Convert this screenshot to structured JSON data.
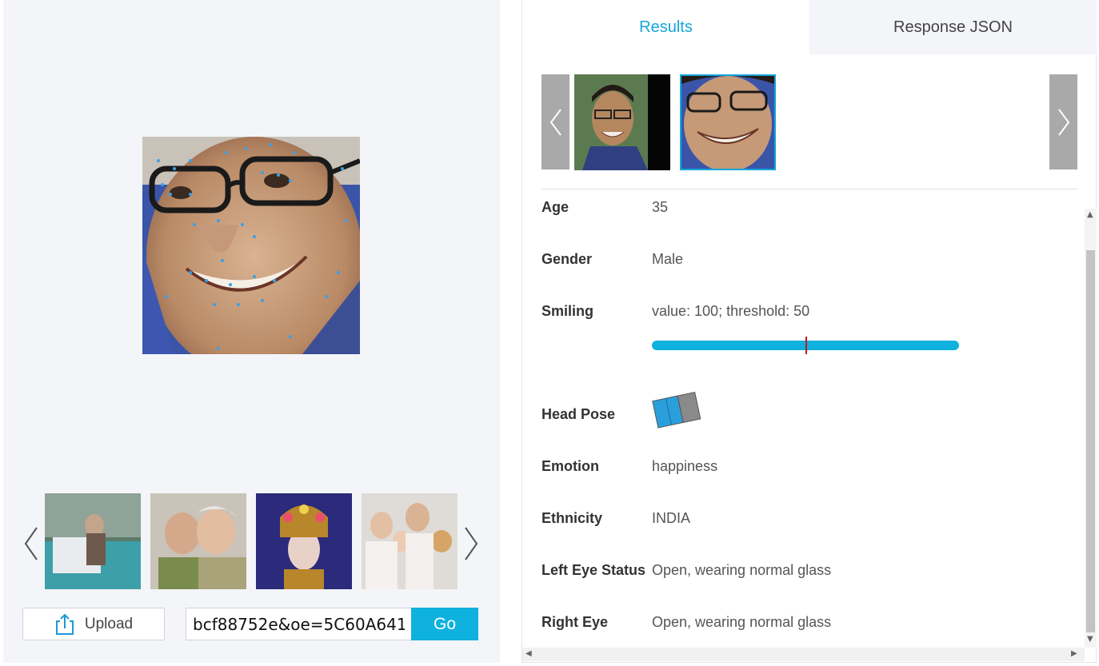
{
  "left": {
    "url_input_value": "bcf88752e&oe=5C60A641",
    "upload_label": "Upload",
    "go_label": "Go"
  },
  "tabs": {
    "results": "Results",
    "response_json": "Response JSON"
  },
  "attributes": [
    {
      "label": "Age",
      "value": "35"
    },
    {
      "label": "Gender",
      "value": "Male"
    },
    {
      "label": "Smiling",
      "value": "value: 100; threshold: 50"
    },
    {
      "label": "Head Pose",
      "value": ""
    },
    {
      "label": "Emotion",
      "value": "happiness"
    },
    {
      "label": "Ethnicity",
      "value": "INDIA"
    },
    {
      "label": "Left Eye Status",
      "value": "Open, wearing normal glass"
    },
    {
      "label": "Right Eye",
      "value": "Open, wearing normal glass"
    }
  ],
  "smiling": {
    "value": 100,
    "threshold": 50,
    "bar_color": "#0fb1de",
    "threshold_color": "#c21a1a"
  },
  "colors": {
    "accent": "#13a6d8",
    "button": "#0fb1de",
    "panel_bg": "#f4f5f9"
  },
  "icons": [
    "upload-icon",
    "chevron-left-icon",
    "chevron-right-icon",
    "head-pose-icon"
  ]
}
